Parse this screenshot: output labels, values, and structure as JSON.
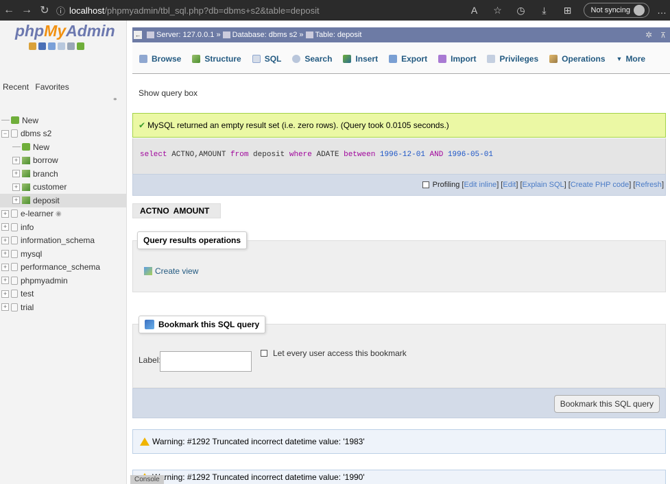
{
  "browser": {
    "url_host": "localhost",
    "url_path": "/phpmyadmin/tbl_sql.php?db=dbms+s2&table=deposit",
    "sync_label": "Not syncing"
  },
  "sidebar": {
    "logo_php": "php",
    "logo_my": "My",
    "logo_admin": "Admin",
    "recent": "Recent",
    "favorites": "Favorites",
    "tree": [
      {
        "label": "New",
        "level": 0
      },
      {
        "label": "dbms s2",
        "level": 0
      },
      {
        "label": "New",
        "level": 1
      },
      {
        "label": "borrow",
        "level": 1
      },
      {
        "label": "branch",
        "level": 1
      },
      {
        "label": "customer",
        "level": 1
      },
      {
        "label": "deposit",
        "level": 1
      },
      {
        "label": "e-learner",
        "level": 0
      },
      {
        "label": "info",
        "level": 0
      },
      {
        "label": "information_schema",
        "level": 0
      },
      {
        "label": "mysql",
        "level": 0
      },
      {
        "label": "performance_schema",
        "level": 0
      },
      {
        "label": "phpmyadmin",
        "level": 0
      },
      {
        "label": "test",
        "level": 0
      },
      {
        "label": "trial",
        "level": 0
      }
    ]
  },
  "breadcrumb": {
    "server": "Server: 127.0.0.1 »",
    "database": "Database: dbms s2 »",
    "table": "Table: deposit"
  },
  "tabs": {
    "browse": "Browse",
    "structure": "Structure",
    "sql": "SQL",
    "search": "Search",
    "insert": "Insert",
    "export": "Export",
    "import": "Import",
    "privileges": "Privileges",
    "operations": "Operations",
    "more": "More"
  },
  "main": {
    "show_query_box": "Show query box",
    "success_message": "MySQL returned an empty result set (i.e. zero rows). (Query took 0.0105 seconds.)",
    "sql": {
      "select": "select",
      "cols": " ACTNO,AMOUNT ",
      "from": "from",
      "table": " deposit ",
      "where": "where",
      "col2": " ADATE ",
      "between": "between",
      "v1": " 1996-12-01 ",
      "and": "AND",
      "v2": " 1996-05-01"
    },
    "profiling": "Profiling",
    "links": {
      "edit_inline": "Edit inline",
      "edit": "Edit",
      "explain": "Explain SQL",
      "php_code": "Create PHP code",
      "refresh": "Refresh"
    },
    "columns": [
      "ACTNO",
      "AMOUNT"
    ],
    "qro_legend": "Query results operations",
    "create_view": "Create view",
    "bookmark_legend": "Bookmark this SQL query",
    "label": "Label:",
    "share_bookmark": "Let every user access this bookmark",
    "bookmark_button": "Bookmark this SQL query",
    "warning1": "Warning: #1292 Truncated incorrect datetime value: '1983'",
    "warning2": "Warning: #1292 Truncated incorrect datetime value: '1990'",
    "console": "Console"
  },
  "colors": {
    "server_bar": "#6d7ba5",
    "success_bg": "#ebf8a4",
    "link": "#4a7bc6"
  }
}
